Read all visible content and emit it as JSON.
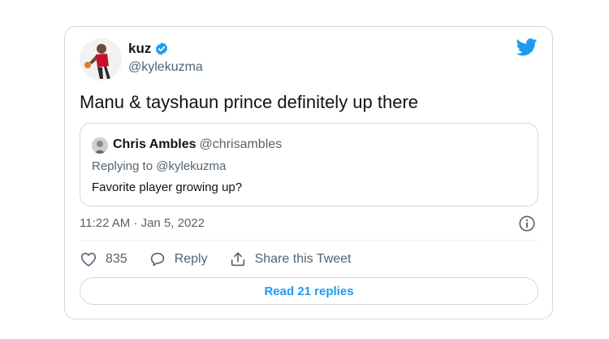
{
  "author": {
    "display_name": "kuz",
    "handle": "@kylekuzma",
    "verified": true
  },
  "tweet": {
    "text": "Manu & tayshaun prince definitely up there",
    "timestamp": "11:22 AM · Jan 5, 2022"
  },
  "quoted_tweet": {
    "display_name": "Chris Ambles",
    "handle": "@chrisambles",
    "replying_prefix": "Replying to",
    "replying_to": "@kylekuzma",
    "text": "Favorite player growing up?"
  },
  "actions": {
    "like_count": "835",
    "reply_label": "Reply",
    "share_label": "Share this Tweet"
  },
  "read_replies_label": "Read 21 replies",
  "icons": {
    "brand": "twitter-bird-icon",
    "verified": "verified-badge-icon",
    "info": "info-icon",
    "like": "heart-icon",
    "reply": "reply-bubble-icon",
    "share": "share-upload-icon"
  },
  "colors": {
    "brand_blue": "#1d9bf0",
    "text_primary": "#0f1419",
    "text_secondary": "#536471",
    "border": "#cfd9de"
  }
}
